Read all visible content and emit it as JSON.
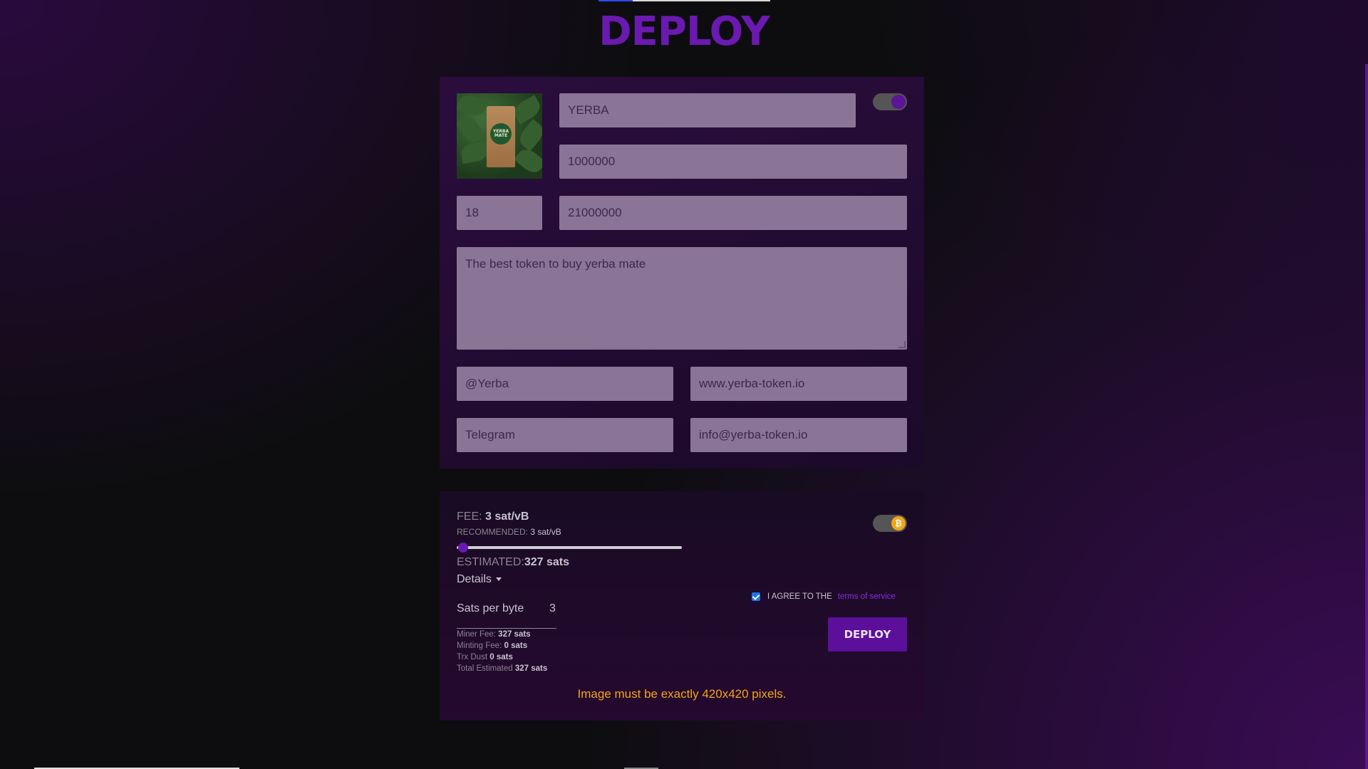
{
  "page": {
    "title": "DEPLOY"
  },
  "form": {
    "ticker": "YERBA",
    "supply": "1000000",
    "decimals": "18",
    "max_supply": "21000000",
    "description": "The best token to buy yerba mate",
    "twitter": "@Yerba",
    "website": "www.yerba-token.io",
    "telegram": "Telegram",
    "email": "info@yerba-token.io",
    "image_alt": "Yerba mate package",
    "image_label": "YERBA MATE"
  },
  "toggles": {
    "top_toggle_on": true,
    "btc_toggle_on": true,
    "btc_symbol": "₿"
  },
  "fee": {
    "fee_label": "FEE:",
    "fee_value": "3 sat/vB",
    "recommended_label": "RECOMMENDED:",
    "recommended_value": "3 sat/vB",
    "estimated_label": "ESTIMATED:",
    "estimated_value": "327 sats",
    "details_label": "Details",
    "sats_per_byte_label": "Sats per byte",
    "sats_per_byte_value": "3",
    "miner_fee_label": "Miner Fee:",
    "miner_fee_value": "327 sats",
    "minting_fee_label": "Minting Fee:",
    "minting_fee_value": "0 sats",
    "trx_dust_label": "Trx Dust",
    "trx_dust_value": "0 sats",
    "total_label": "Total Estimated",
    "total_value": "327 sats",
    "slider_level": 0.0
  },
  "actions": {
    "agree_text": "I AGREE TO THE",
    "tos_link": "terms of service",
    "agree_checked": true,
    "deploy_label": "DEPLOY"
  },
  "messages": {
    "warning": "Image must be exactly 420x420 pixels."
  },
  "colors": {
    "accent": "#5b0f9a",
    "title": "#6a1ab0",
    "warning": "#f2a517",
    "field_bg": "#8a7596"
  }
}
